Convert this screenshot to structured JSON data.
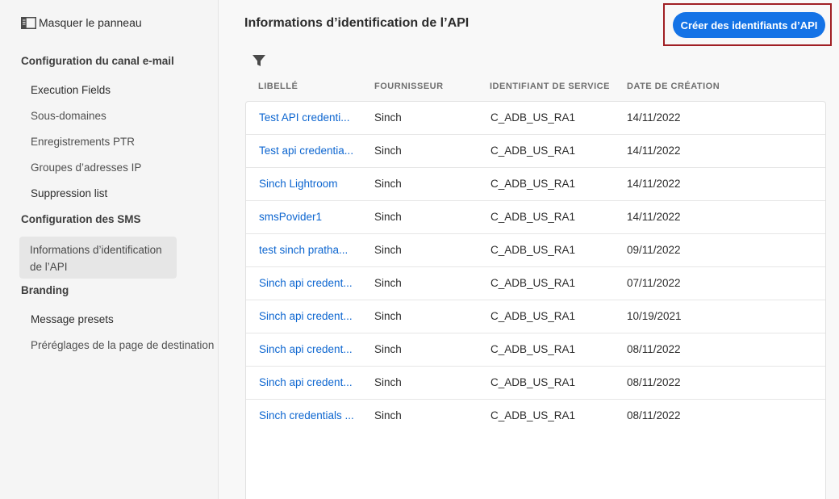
{
  "sidebar": {
    "hide_panel": "Masquer le panneau",
    "sections": [
      {
        "title": "Configuration du canal e-mail"
      },
      {
        "title": "Configuration des SMS"
      },
      {
        "title": "Branding"
      }
    ],
    "items": {
      "execution_fields": "Execution Fields",
      "sous_domaines": "Sous-domaines",
      "ptr": "Enregistrements PTR",
      "ip_groups": "Groupes d’adresses IP",
      "suppression": "Suppression list",
      "api_credentials": "Informations d’identification de l’API",
      "message_presets": "Message presets",
      "landing_presets": "Préréglages de la page de destination"
    }
  },
  "main": {
    "title": "Informations d’identification de l’API",
    "create_button": "Créer des identifiants d’API",
    "columns": {
      "label": "LIBELLÉ",
      "provider": "FOURNISSEUR",
      "service_id": "IDENTIFIANT DE SERVICE",
      "created": "DATE DE CRÉATION"
    },
    "rows": [
      {
        "label": "Test API credenti...",
        "provider": "Sinch",
        "service_id": "C_ADB_US_RA1",
        "created": "14/11/2022"
      },
      {
        "label": "Test api credentia...",
        "provider": "Sinch",
        "service_id": "C_ADB_US_RA1",
        "created": "14/11/2022"
      },
      {
        "label": "Sinch Lightroom",
        "provider": "Sinch",
        "service_id": "C_ADB_US_RA1",
        "created": "14/11/2022"
      },
      {
        "label": "smsPovider1",
        "provider": "Sinch",
        "service_id": "C_ADB_US_RA1",
        "created": "14/11/2022"
      },
      {
        "label": "test sinch pratha...",
        "provider": "Sinch",
        "service_id": "C_ADB_US_RA1",
        "created": "09/11/2022"
      },
      {
        "label": "Sinch api credent...",
        "provider": "Sinch",
        "service_id": "C_ADB_US_RA1",
        "created": "07/11/2022"
      },
      {
        "label": "Sinch api credent...",
        "provider": "Sinch",
        "service_id": "C_ADB_US_RA1",
        "created": "10/19/2021"
      },
      {
        "label": "Sinch api credent...",
        "provider": "Sinch",
        "service_id": "C_ADB_US_RA1",
        "created": "08/11/2022"
      },
      {
        "label": "Sinch api credent...",
        "provider": "Sinch",
        "service_id": "C_ADB_US_RA1",
        "created": "08/11/2022"
      },
      {
        "label": "Sinch credentials ...",
        "provider": "Sinch",
        "service_id": "C_ADB_US_RA1",
        "created": "08/11/2022"
      }
    ]
  },
  "icons": {
    "panel": "panel-toggle-icon",
    "filter": "filter-icon"
  },
  "colors": {
    "accent": "#1473e6",
    "link": "#0d66d0",
    "highlight_border": "#a01f24"
  }
}
